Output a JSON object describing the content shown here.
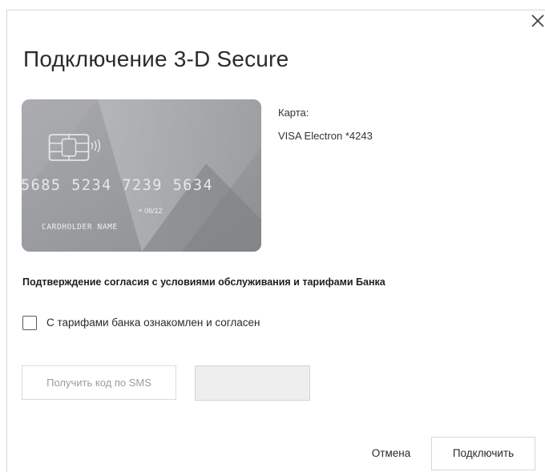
{
  "dialog": {
    "title": "Подключение 3-D Secure",
    "close_icon": "close-icon"
  },
  "card": {
    "number": "5685 5234 7239 5634",
    "expiry": "06/12",
    "expiry_mark": "≡",
    "holder": "CARDHOLDER NAME",
    "chip_icon": "card-chip-icon",
    "contactless_icon": "contactless-icon",
    "colors": {
      "base": "#9b9da0",
      "light": "#b4b6b9",
      "dark": "#7f8185"
    }
  },
  "card_info": {
    "label": "Карта:",
    "value": "VISA Electron *4243"
  },
  "consent": {
    "heading": "Подтверждение согласия с условиями обслуживания и тарифами Банка",
    "checkbox_label": "С тарифами банка ознакомлен и согласен",
    "checked": false
  },
  "sms": {
    "button_label": "Получить код по SMS",
    "code_value": "",
    "code_placeholder": ""
  },
  "actions": {
    "cancel_label": "Отмена",
    "connect_label": "Подключить"
  }
}
